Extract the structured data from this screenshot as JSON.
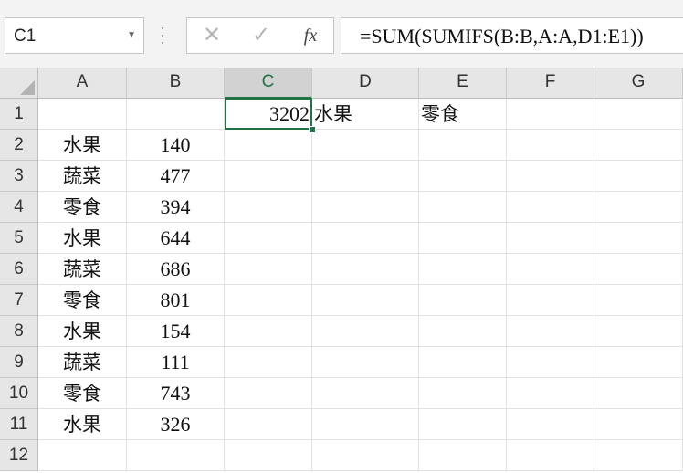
{
  "name_box": {
    "value": "C1"
  },
  "formula_bar": {
    "cancel_icon": "✕",
    "enter_icon": "✓",
    "fx_label": "fx",
    "formula": "=SUM(SUMIFS(B:B,A:A,D1:E1))"
  },
  "columns": [
    "A",
    "B",
    "C",
    "D",
    "E",
    "F",
    "G"
  ],
  "rows": [
    "1",
    "2",
    "3",
    "4",
    "5",
    "6",
    "7",
    "8",
    "9",
    "10",
    "11",
    "12"
  ],
  "cells": {
    "C1": "3202",
    "D1": "水果",
    "E1": "零食",
    "A2": "水果",
    "B2": "140",
    "A3": "蔬菜",
    "B3": "477",
    "A4": "零食",
    "B4": "394",
    "A5": "水果",
    "B5": "644",
    "A6": "蔬菜",
    "B6": "686",
    "A7": "零食",
    "B7": "801",
    "A8": "水果",
    "B8": "154",
    "A9": "蔬菜",
    "B9": "111",
    "A10": "零食",
    "B10": "743",
    "A11": "水果",
    "B11": "326"
  },
  "active_cell": "C1",
  "colors": {
    "accent": "#217346",
    "header_bg": "#e6e6e6",
    "grid_line": "#e1e1e1"
  }
}
